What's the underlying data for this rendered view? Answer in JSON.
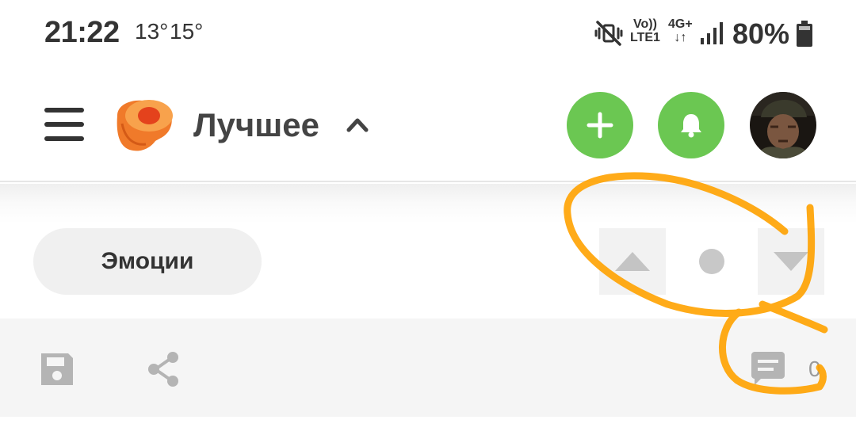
{
  "status_bar": {
    "time": "21:22",
    "temp_1": "13°",
    "temp_2": "15°",
    "volte_top": "Vo))",
    "volte_bottom": "LTE1",
    "network_top": "4G+",
    "network_bottom": "↓↑",
    "battery": "80%"
  },
  "header": {
    "title": "Лучшее",
    "add_icon": "plus-icon",
    "bell_icon": "bell-icon",
    "accent_color": "#6bc752",
    "logo_color": "#f07a2a"
  },
  "filter": {
    "tag_label": "Эмоции"
  },
  "actions": {
    "comment_count": "0"
  },
  "annotation": {
    "stroke_color": "#ffa200"
  }
}
